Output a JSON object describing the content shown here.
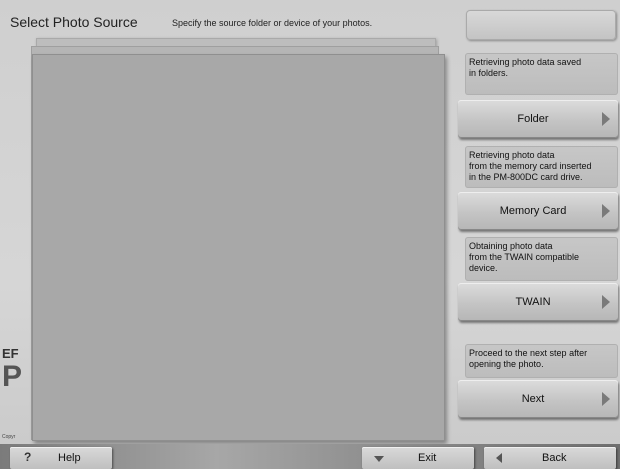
{
  "header": {
    "title": "Select Photo Source",
    "subtitle": "Specify the source folder or device of your photos."
  },
  "left": {
    "brand_small": "EF",
    "brand_big": "P",
    "copyright": "Copyr"
  },
  "sources": [
    {
      "description": "Retrieving photo data saved\nin folders.",
      "button_label": "Folder"
    },
    {
      "description": "Retrieving photo data\nfrom the memory card inserted\nin the PM-800DC card drive.",
      "button_label": "Memory Card"
    },
    {
      "description": "Obtaining photo data\nfrom the TWAIN compatible\ndevice.",
      "button_label": "TWAIN"
    }
  ],
  "next": {
    "description": "Proceed to the next step after\nopening the photo.",
    "button_label": "Next"
  },
  "footer": {
    "help_label": "Help",
    "help_symbol": "?",
    "exit_label": "Exit",
    "back_label": "Back"
  }
}
